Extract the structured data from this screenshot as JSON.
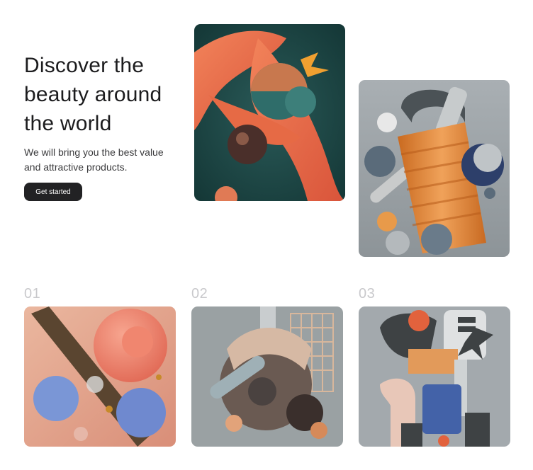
{
  "hero": {
    "title": "Discover the beauty around the world",
    "subtitle": "We will bring you the best value and attractive products.",
    "cta_label": "Get started"
  },
  "featured": [
    {
      "name": "orange fabric sculpture"
    },
    {
      "name": "orange ribbed column sculpture"
    }
  ],
  "gallery": [
    {
      "number": "01"
    },
    {
      "number": "02"
    },
    {
      "number": "03"
    }
  ],
  "colors": {
    "text": "#1c1c1e",
    "button": "#222224",
    "number": "#c9c9cc"
  }
}
